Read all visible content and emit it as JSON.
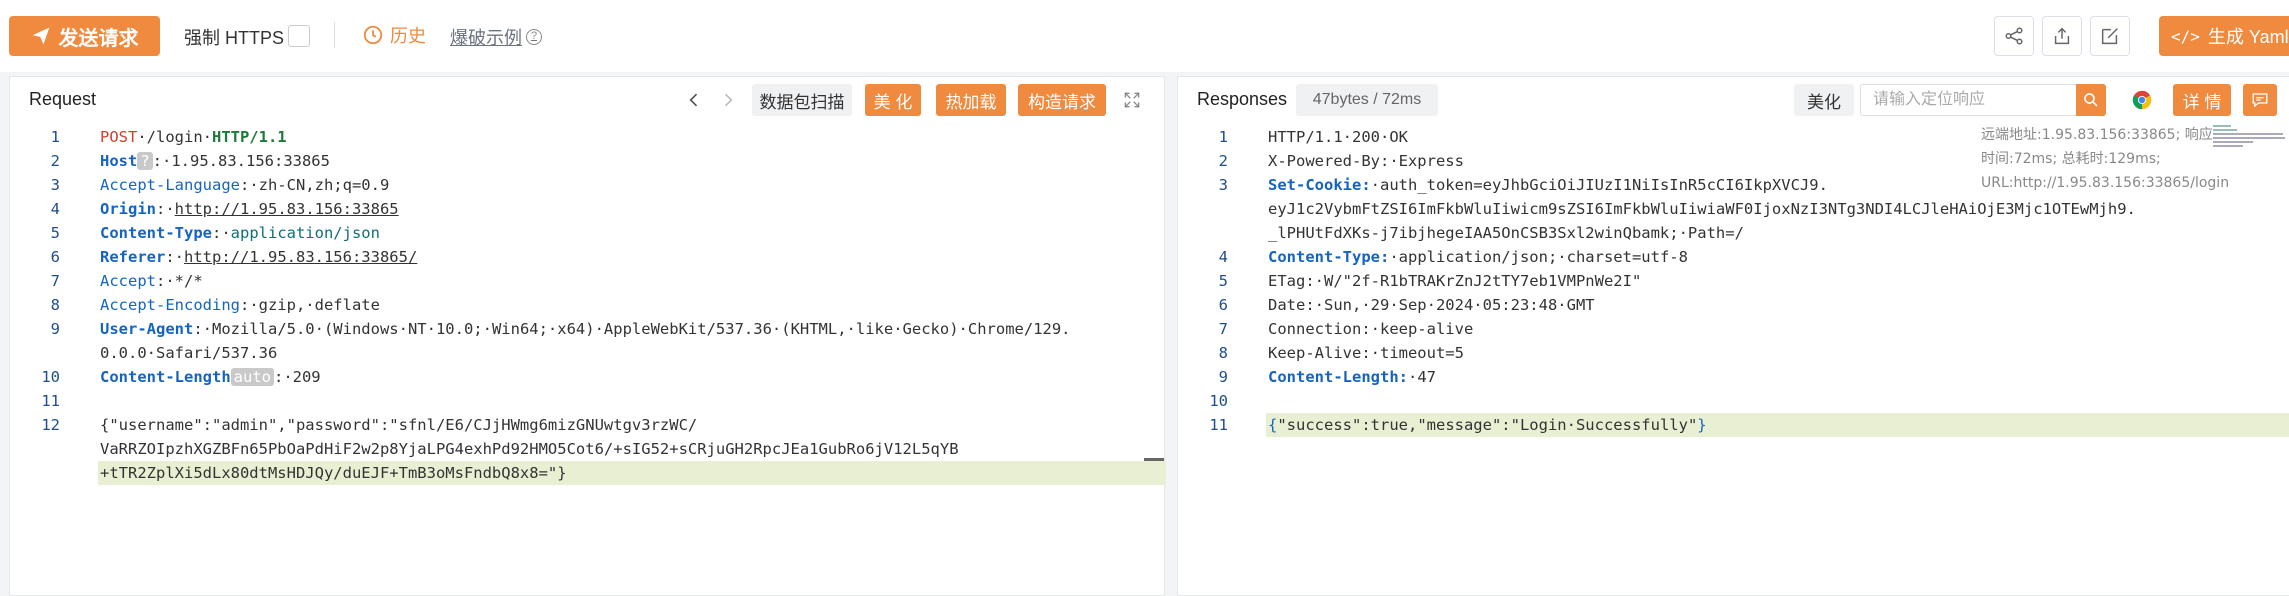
{
  "toolbar": {
    "send_label": "发送请求",
    "https_label": "强制 HTTPS",
    "history_label": "历史",
    "burst_label": "爆破示例",
    "yaml_label": "生成 Yaml 模"
  },
  "request": {
    "title": "Request",
    "scan_label": "数据包扫描",
    "beautify_label": "美 化",
    "hotload_label": "热加载",
    "construct_label": "构造请求",
    "lines": [
      {
        "n": "1",
        "parts": [
          [
            "k-red",
            "POST"
          ],
          [
            "k-dark",
            "·/login·"
          ],
          [
            "k-green",
            "HTTP/1.1"
          ]
        ]
      },
      {
        "n": "2",
        "parts": [
          [
            "k-bold-blue",
            "Host"
          ],
          [
            "tag-gray",
            "?"
          ],
          [
            "k-dark",
            ":·1.95.83.156:33865"
          ]
        ]
      },
      {
        "n": "3",
        "parts": [
          [
            "k-blue",
            "Accept-Language"
          ],
          [
            "k-dark",
            ":·zh-CN,zh;q=0.9"
          ]
        ]
      },
      {
        "n": "4",
        "parts": [
          [
            "k-bold-blue",
            "Origin"
          ],
          [
            "k-dark",
            ":·"
          ],
          [
            "k-dark ul",
            "http://1.95.83.156:33865"
          ]
        ]
      },
      {
        "n": "5",
        "parts": [
          [
            "k-bold-blue",
            "Content-Type"
          ],
          [
            "k-dark",
            ":·"
          ],
          [
            "k-teal",
            "application/json"
          ]
        ]
      },
      {
        "n": "6",
        "parts": [
          [
            "k-bold-blue",
            "Referer"
          ],
          [
            "k-dark",
            ":·"
          ],
          [
            "k-dark ul",
            "http://1.95.83.156:33865/"
          ]
        ]
      },
      {
        "n": "7",
        "parts": [
          [
            "k-blue",
            "Accept"
          ],
          [
            "k-dark",
            ":·*/*"
          ]
        ]
      },
      {
        "n": "8",
        "parts": [
          [
            "k-blue",
            "Accept-Encoding"
          ],
          [
            "k-dark",
            ":·gzip,·deflate"
          ]
        ]
      },
      {
        "n": "9",
        "parts": [
          [
            "k-bold-blue",
            "User-Agent"
          ],
          [
            "k-dark",
            ":·Mozilla/5.0·(Windows·NT·10.0;·Win64;·x64)·AppleWebKit/537.36·(KHTML,·like·Gecko)·Chrome/129."
          ]
        ]
      },
      {
        "n": "",
        "parts": [
          [
            "k-dark",
            "0.0.0·Safari/537.36"
          ]
        ]
      },
      {
        "n": "10",
        "parts": [
          [
            "k-bold-blue",
            "Content-Length"
          ],
          [
            "tag-gray",
            "auto"
          ],
          [
            "k-dark",
            ":·209"
          ]
        ]
      },
      {
        "n": "11",
        "parts": []
      },
      {
        "n": "12",
        "parts": [
          [
            "k-dark",
            "{\"username\":\"admin\",\"password\":\"sfnl/E6/CJjHWmg6mizGNUwtgv3rzWC/"
          ]
        ]
      },
      {
        "n": "",
        "parts": [
          [
            "k-dark",
            "VaRRZOIpzhXGZBFn65PbOaPdHiF2w2p8YjaLPG4exhPd92HMO5Cot6/+sIG52+sCRjuGH2RpcJEa1GubRo6jV12L5qYB"
          ]
        ]
      },
      {
        "n": "",
        "parts": [
          [
            "k-dark",
            "+tTR2ZplXi5dLx80dtMsHDJQy/duEJF+TmB3oMsFndbQ8x8=\"}"
          ]
        ]
      }
    ]
  },
  "response": {
    "title": "Responses",
    "size_badge": "47bytes / 72ms",
    "beautify_label": "美化",
    "search_placeholder": "请输入定位响应",
    "details_label": "详 情",
    "meta_text": "远端地址:1.95.83.156:33865; 响应时间:72ms; 总耗时:129ms; URL:http://1.95.83.156:33865/login",
    "lines": [
      {
        "n": "1",
        "parts": [
          [
            "k-dark",
            "HTTP/1.1·200·OK"
          ]
        ]
      },
      {
        "n": "2",
        "parts": [
          [
            "k-dark",
            "X-Powered-By:·Express"
          ]
        ]
      },
      {
        "n": "3",
        "parts": [
          [
            "k-bold-blue",
            "Set-Cookie:"
          ],
          [
            "k-dark",
            "·auth_token=eyJhbGciOiJIUzI1NiIsInR5cCI6IkpXVCJ9."
          ]
        ]
      },
      {
        "n": "",
        "parts": [
          [
            "k-dark",
            "eyJ1c2VybmFtZSI6ImFkbWluIiwicm9sZSI6ImFkbWluIiwiaWF0IjoxNzI3NTg3NDI4LCJleHAiOjE3Mjc1OTEwMjh9."
          ]
        ]
      },
      {
        "n": "",
        "parts": [
          [
            "k-dark",
            "_lPHUtFdXKs-j7ibjhegeIAA5OnCSB3Sxl2winQbamk;·Path=/"
          ]
        ]
      },
      {
        "n": "4",
        "parts": [
          [
            "k-bold-blue",
            "Content-Type:"
          ],
          [
            "k-dark",
            "·application/json;·charset=utf-8"
          ]
        ]
      },
      {
        "n": "5",
        "parts": [
          [
            "k-dark",
            "ETag:·W/\"2f-R1bTRAKrZnJ2tTY7eb1VMPnWe2I\""
          ]
        ]
      },
      {
        "n": "6",
        "parts": [
          [
            "k-dark",
            "Date:·Sun,·29·Sep·2024·05:23:48·GMT"
          ]
        ]
      },
      {
        "n": "7",
        "parts": [
          [
            "k-dark",
            "Connection:·keep-alive"
          ]
        ]
      },
      {
        "n": "8",
        "parts": [
          [
            "k-dark",
            "Keep-Alive:·timeout=5"
          ]
        ]
      },
      {
        "n": "9",
        "parts": [
          [
            "k-bold-blue",
            "Content-Length:"
          ],
          [
            "k-dark",
            "·47"
          ]
        ]
      },
      {
        "n": "10",
        "parts": []
      },
      {
        "n": "11",
        "parts": [
          [
            "k-blue",
            "{"
          ],
          [
            "k-dark",
            "\"success\":true,\"message\":\"Login·Successfully\""
          ],
          [
            "k-blue",
            "}"
          ]
        ]
      }
    ]
  }
}
